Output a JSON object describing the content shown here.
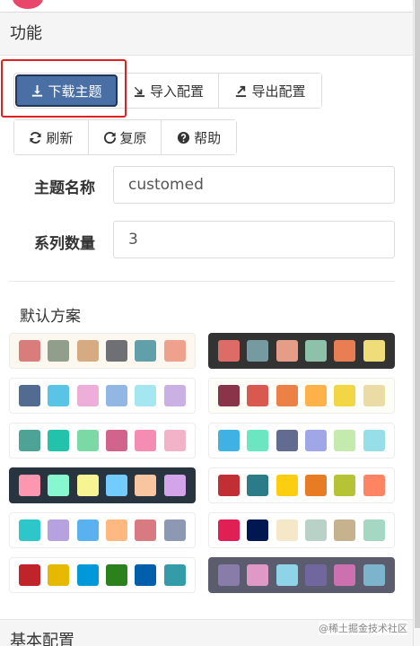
{
  "sections": {
    "function_title": "功能",
    "basic_title": "基本配置"
  },
  "toolbar": {
    "download_label": "下载主题",
    "import_label": "导入配置",
    "export_label": "导出配置",
    "refresh_label": "刷新",
    "reset_label": "复原",
    "help_label": "帮助"
  },
  "form": {
    "theme_name_label": "主题名称",
    "theme_name_value": "customed",
    "series_count_label": "系列数量",
    "series_count_value": "3"
  },
  "schemes": {
    "title": "默认方案",
    "palettes": [
      {
        "bg": "#fdf8ef",
        "colors": [
          "#d87c7c",
          "#919e8b",
          "#d7ab82",
          "#6e7074",
          "#61a0a8",
          "#efa18d"
        ]
      },
      {
        "bg": "#333333",
        "colors": [
          "#dd6b66",
          "#759aa0",
          "#e69d87",
          "#8dc1a9",
          "#ea7e53",
          "#eedd78"
        ]
      },
      {
        "bg": "#ffffff",
        "colors": [
          "#516b91",
          "#59c4e6",
          "#edafda",
          "#93b7e3",
          "#a5e7f0",
          "#cbb0e3"
        ]
      },
      {
        "bg": "#fefef8",
        "colors": [
          "#893448",
          "#d95850",
          "#eb8146",
          "#ffb248",
          "#f2d643",
          "#ebdba4"
        ]
      },
      {
        "bg": "#ffffff",
        "colors": [
          "#4ea397",
          "#22c3aa",
          "#7bd9a5",
          "#d0648a",
          "#f58db2",
          "#f2b3c9"
        ]
      },
      {
        "bg": "#ffffff",
        "colors": [
          "#3fb1e3",
          "#6be6c1",
          "#626c91",
          "#a0a7e6",
          "#c4ebad",
          "#96dee8"
        ]
      },
      {
        "bg": "#293441",
        "colors": [
          "#fc97af",
          "#87f7cf",
          "#f7f494",
          "#72ccff",
          "#f7c5a0",
          "#d4a4eb"
        ]
      },
      {
        "bg": "#ffffff",
        "colors": [
          "#c12e34",
          "#2b7b88",
          "#fcce10",
          "#e87c25",
          "#b5c334",
          "#fe8463"
        ]
      },
      {
        "bg": "#ffffff",
        "colors": [
          "#2ec7c9",
          "#b6a2de",
          "#5ab1ef",
          "#ffb980",
          "#d87a80",
          "#8d98b3"
        ]
      },
      {
        "bg": "#ffffff",
        "colors": [
          "#e01f54",
          "#001852",
          "#f5e8c8",
          "#b8d2c7",
          "#c6b38e",
          "#a4d8c2"
        ]
      },
      {
        "bg": "#ffffff",
        "colors": [
          "#c1232b",
          "#e7b800",
          "#0098d9",
          "#2b821d",
          "#005eaa",
          "#339ca8"
        ]
      },
      {
        "bg": "#5b5c6e",
        "colors": [
          "#8a7ca8",
          "#e098c7",
          "#8fd3e8",
          "#71669e",
          "#cc70af",
          "#7cb4cc"
        ]
      }
    ]
  },
  "watermark": "@稀土掘金技术社区",
  "icons": {
    "download": "download-icon",
    "import": "import-icon",
    "export": "export-icon",
    "refresh": "refresh-icon",
    "reset": "reset-icon",
    "help": "help-icon"
  },
  "colors": {
    "primary": "#4a6fa5",
    "highlight": "#e02020"
  }
}
